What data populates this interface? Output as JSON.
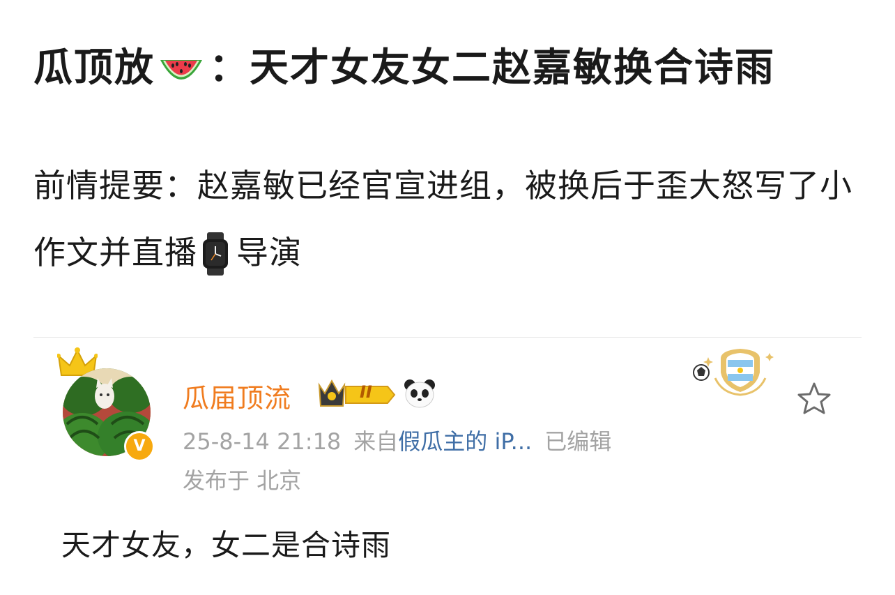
{
  "post": {
    "title_prefix": "瓜顶放",
    "title_suffix": "：天才女友女二赵嘉敏换合诗雨",
    "intro_part1": "前情提要：赵嘉敏已经官宣进组，被换后于歪大怒写了小作文并直播",
    "intro_part2": "导演",
    "icons": [
      "watermelon-emoji",
      "watch-emoji"
    ]
  },
  "comment": {
    "username": "瓜届顶流",
    "level_badge_text": "II",
    "verified_badge": "V",
    "date": "25-8-14 21:18",
    "source_prefix": "来自",
    "source_device": "假瓜主的 iP...",
    "edited": "已编辑",
    "location": "发布于 北京",
    "content": "天才女友，女二是合诗雨",
    "icons": [
      "crown-icon",
      "panda-icon",
      "medal-badge-icon",
      "star-icon"
    ],
    "colors": {
      "username": "#f07c1f",
      "link": "#3f6ea6",
      "meta": "#a3a3a3"
    }
  }
}
